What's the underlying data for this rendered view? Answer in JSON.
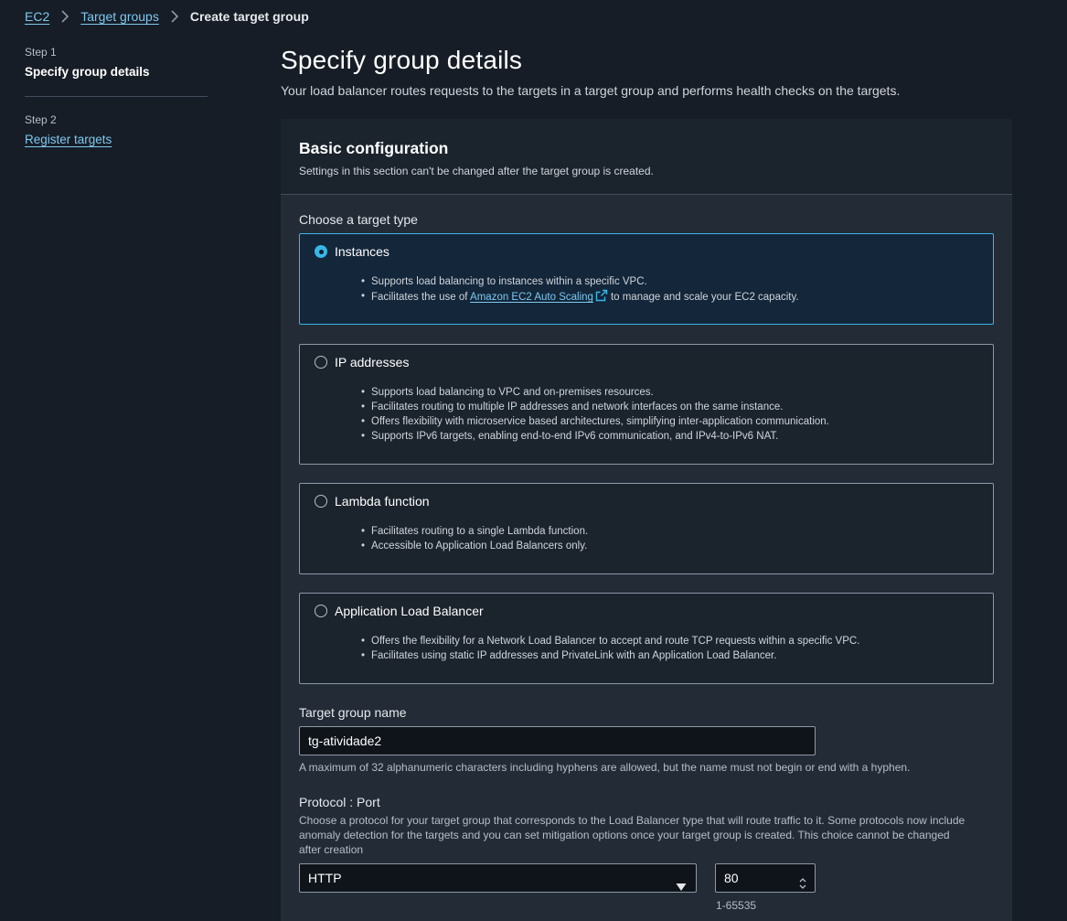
{
  "breadcrumb": {
    "items": [
      "EC2",
      "Target groups"
    ],
    "current": "Create target group"
  },
  "steps": [
    {
      "label": "Step 1",
      "title": "Specify group details"
    },
    {
      "label": "Step 2",
      "title": "Register targets"
    }
  ],
  "header": {
    "title": "Specify group details",
    "description": "Your load balancer routes requests to the targets in a target group and performs health checks on the targets."
  },
  "basic": {
    "title": "Basic configuration",
    "description": "Settings in this section can't be changed after the target group is created.",
    "target_type_label": "Choose a target type",
    "types": [
      {
        "title": "Instances",
        "selected": true,
        "bullets": [
          "Supports load balancing to instances within a specific VPC.",
          "Facilitates the use of",
          "Amazon EC2 Auto Scaling",
          "to manage and scale your EC2 capacity."
        ]
      },
      {
        "title": "IP addresses",
        "selected": false,
        "bullets": [
          "Supports load balancing to VPC and on-premises resources.",
          "Facilitates routing to multiple IP addresses and network interfaces on the same instance.",
          "Offers flexibility with microservice based architectures, simplifying inter-application communication.",
          "Supports IPv6 targets, enabling end-to-end IPv6 communication, and IPv4-to-IPv6 NAT."
        ]
      },
      {
        "title": "Lambda function",
        "selected": false,
        "bullets": [
          "Facilitates routing to a single Lambda function.",
          "Accessible to Application Load Balancers only."
        ]
      },
      {
        "title": "Application Load Balancer",
        "selected": false,
        "bullets": [
          "Offers the flexibility for a Network Load Balancer to accept and route TCP requests within a specific VPC.",
          "Facilitates using static IP addresses and PrivateLink with an Application Load Balancer."
        ]
      }
    ],
    "name_field": {
      "label": "Target group name",
      "value": "tg-atividade2",
      "help": "A maximum of 32 alphanumeric characters including hyphens are allowed, but the name must not begin or end with a hyphen."
    },
    "protocol_port": {
      "label": "Protocol : Port",
      "help_line1": "Choose a protocol for your target group that corresponds to the Load Balancer type that will route traffic to it. Some protocols now include",
      "help_line2": "anomaly detection for the targets and you can set mitigation options once your target group is created. This choice cannot be changed",
      "help_line3": "after creation",
      "protocol": "HTTP",
      "port": "80",
      "port_range": "1-65535"
    }
  },
  "colors": {
    "accent": "#39b6e6",
    "link": "#7ec8ef",
    "background": "#161d26",
    "panel": "#232b37"
  }
}
